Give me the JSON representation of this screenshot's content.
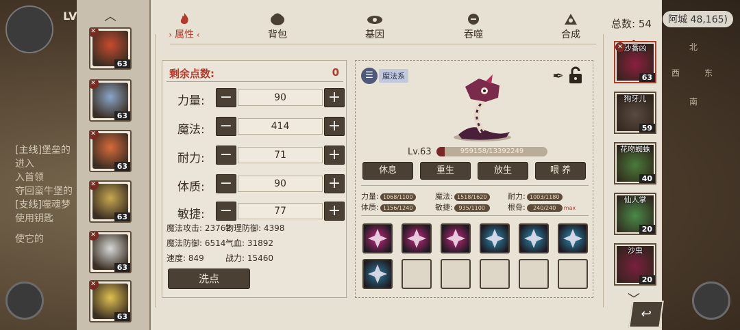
{
  "background": {
    "level_label": "LV",
    "quest_lines": [
      {
        "tag": "[主线]",
        "text": "堡垒的"
      },
      {
        "tag": "",
        "text": "进入"
      },
      {
        "tag": "",
        "text": "入首领"
      },
      {
        "tag": "",
        "text": "夺回蛮牛堡的"
      },
      {
        "tag": "[支线]",
        "text": "噬魂梦"
      },
      {
        "tag": "",
        "text": "使用钥匙"
      },
      {
        "tag": "",
        "text": "使它的"
      }
    ],
    "topright_text": "阿城 48,165)"
  },
  "tabs": [
    {
      "label": "属性",
      "icon": "flame-icon",
      "active": true
    },
    {
      "label": "背包",
      "icon": "bag-icon",
      "active": false
    },
    {
      "label": "基因",
      "icon": "gene-icon",
      "active": false
    },
    {
      "label": "吞噬",
      "icon": "devour-icon",
      "active": false
    },
    {
      "label": "合成",
      "icon": "synthesis-icon",
      "active": false
    }
  ],
  "heroes": [
    {
      "level": "63",
      "color": "#c84a2e"
    },
    {
      "level": "63",
      "color": "#8aa6c8"
    },
    {
      "level": "63",
      "color": "#d86a3a"
    },
    {
      "level": "63",
      "color": "#c8a850"
    },
    {
      "level": "63",
      "color": "#d8d8d8"
    },
    {
      "level": "63",
      "color": "#e0c050"
    }
  ],
  "attributes": {
    "remaining_label": "剩余点数:",
    "remaining_value": "0",
    "stats": [
      {
        "label": "力量:",
        "value": "90"
      },
      {
        "label": "魔法:",
        "value": "414"
      },
      {
        "label": "耐力:",
        "value": "71"
      },
      {
        "label": "体质:",
        "value": "90"
      },
      {
        "label": "敏捷:",
        "value": "77"
      }
    ],
    "derived": [
      {
        "label": "魔法攻击: 23762"
      },
      {
        "label": "物理防御: 4398"
      },
      {
        "label": "魔法防御: 6514"
      },
      {
        "label": "气血: 31892"
      },
      {
        "label": "速度: 849"
      },
      {
        "label": "战力: 15460"
      }
    ],
    "wash_label": "洗点"
  },
  "pet": {
    "type_label": "魔法系",
    "level_label": "Lv.63",
    "hp_text": "959158/13392249",
    "hp_fraction": 0.0716,
    "actions": [
      "休息",
      "重生",
      "放生",
      "喂 养"
    ],
    "growth": [
      {
        "label": "力量:",
        "bar": "1068/1100"
      },
      {
        "label": "魔法:",
        "bar": "1518/1620"
      },
      {
        "label": "耐力:",
        "bar": "1003/1180"
      },
      {
        "label": "体质:",
        "bar": "1156/1240"
      },
      {
        "label": "敏捷:",
        "bar": "935/1100"
      },
      {
        "label": "根骨:",
        "bar": "240/240"
      }
    ],
    "max_label": "max",
    "skills": [
      {
        "color": "#c0287a",
        "name": "pink-claw-skill-icon"
      },
      {
        "color": "#c0287a",
        "name": "pink-burst-skill-icon"
      },
      {
        "color": "#c0287a",
        "name": "pink-star-skill-icon"
      },
      {
        "color": "#2a8ab0",
        "name": "blue-swirl-skill-icon"
      },
      {
        "color": "#2a8ab0",
        "name": "blue-swirl-skill-icon"
      },
      {
        "color": "#2a8ab0",
        "name": "blue-slash-skill-icon"
      },
      {
        "color": "#2a7a9a",
        "name": "blue-orb-skill-icon"
      }
    ]
  },
  "pet_list": {
    "total_label": "总数: 54",
    "pets": [
      {
        "name": "沙番凶",
        "level": "63",
        "color": "#8a2040",
        "selected": true
      },
      {
        "name": "狗牙儿",
        "level": "59",
        "color": "#5a4a40",
        "selected": false
      },
      {
        "name": "花吻蜘蛛",
        "level": "40",
        "color": "#4a7a3a",
        "selected": false
      },
      {
        "name": "仙人掌",
        "level": "20",
        "color": "#4a8a4a",
        "selected": false
      },
      {
        "name": "沙虫",
        "level": "20",
        "color": "#7a2040",
        "selected": false
      }
    ]
  },
  "compass": {
    "north": "北",
    "west": "西",
    "east": "东",
    "south": "南"
  }
}
